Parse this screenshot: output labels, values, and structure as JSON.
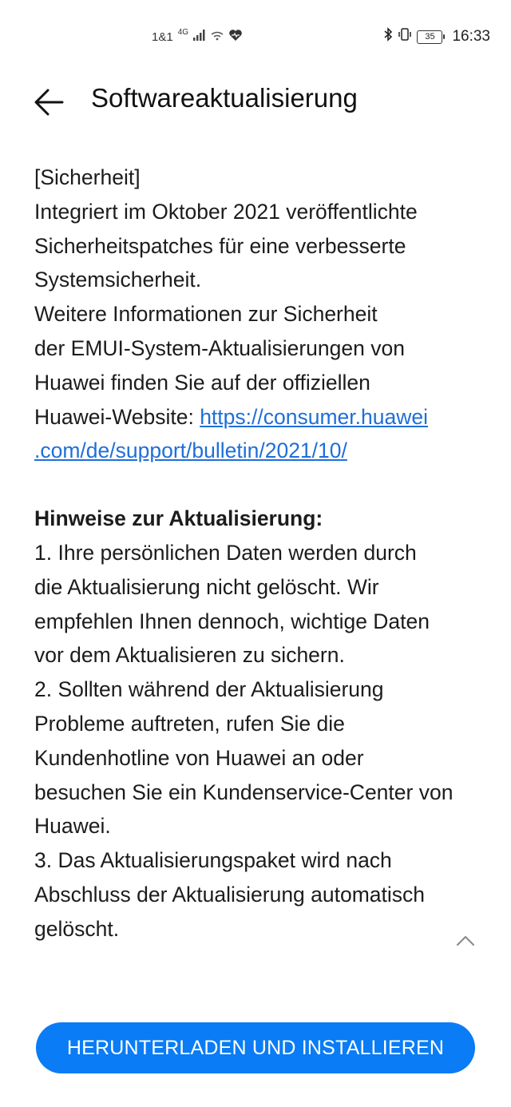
{
  "status_bar": {
    "carrier": "1&1",
    "network": "4G",
    "time": "16:33",
    "battery": "35",
    "icons": [
      "signal-icon",
      "wifi-icon",
      "heart-icon",
      "bluetooth-icon",
      "vibrate-icon",
      "battery-icon"
    ]
  },
  "header": {
    "back_icon": "arrow-left-icon",
    "title": "Softwareaktualisierung"
  },
  "security": {
    "heading": "[Sicherheit]",
    "lines": [
      "Integriert im Oktober 2021 veröffentlichte",
      "Sicherheitspatches für eine verbesserte",
      "Systemsicherheit.",
      "Weitere Informationen zur Sicherheit",
      "der EMUI-System-Aktualisierungen von",
      "Huawei finden Sie auf der offiziellen"
    ],
    "link_prefix": "Huawei-Website: ",
    "link_part1": "https://consumer.huawei",
    "link_part2": ".com/de/support/bulletin/2021/10/"
  },
  "notes": {
    "heading": "Hinweise zur Aktualisierung:",
    "lines": [
      "1. Ihre persönlichen Daten werden durch",
      "die Aktualisierung nicht gelöscht. Wir",
      "empfehlen Ihnen dennoch, wichtige Daten",
      "vor dem Aktualisieren zu sichern.",
      "2. Sollten während der Aktualisierung",
      "Probleme auftreten, rufen Sie die",
      "Kundenhotline von Huawei an oder",
      "besuchen Sie ein Kundenservice-Center von",
      "Huawei.",
      "3. Das Aktualisierungspaket wird nach",
      "Abschluss der Aktualisierung automatisch",
      "gelöscht."
    ],
    "collapse_icon": "chevron-up-icon"
  },
  "actions": {
    "primary_label": "HERUNTERLADEN UND INSTALLIEREN",
    "primary_color": "#0a7cf5",
    "link_color": "#1e6fd9"
  }
}
